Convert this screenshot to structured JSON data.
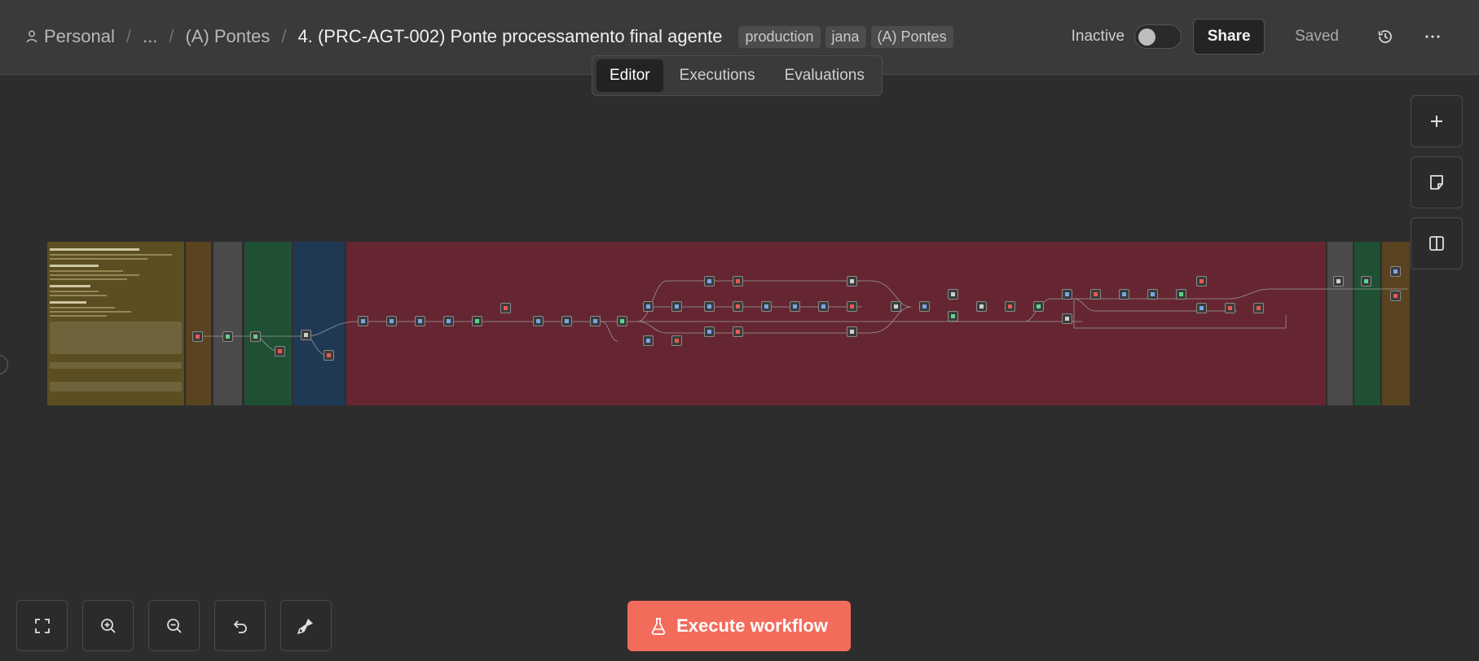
{
  "header": {
    "breadcrumbs": [
      {
        "label": "Personal",
        "icon": "person-icon"
      },
      {
        "label": "..."
      },
      {
        "label": "(A) Pontes"
      },
      {
        "label": "4. (PRC-AGT-002) Ponte processamento final agente"
      }
    ],
    "tags": [
      "production",
      "jana",
      "(A) Pontes"
    ],
    "status_label": "Inactive",
    "active": false,
    "share_label": "Share",
    "saved_label": "Saved",
    "icons": [
      "history-icon",
      "more-options-icon"
    ]
  },
  "tabs": [
    {
      "label": "Editor",
      "active": true
    },
    {
      "label": "Executions",
      "active": false
    },
    {
      "label": "Evaluations",
      "active": false
    }
  ],
  "side_toolbar": {
    "icons": [
      "add-node-icon",
      "sticky-note-icon",
      "side-panel-icon"
    ]
  },
  "bottom_toolbar": {
    "icons": [
      "fit-view-icon",
      "zoom-in-icon",
      "zoom-out-icon",
      "undo-icon",
      "clear-execution-icon"
    ]
  },
  "execute": {
    "label": "Execute workflow",
    "icon": "flask-icon"
  },
  "colors": {
    "accent": "#f26b5b",
    "sticky_yellow": "#5b4f21",
    "sticky_brown": "#5a4321",
    "sticky_grey": "#4a4a4a",
    "sticky_green": "#1f5034",
    "sticky_blue": "#1f3954",
    "sticky_red": "#652631"
  }
}
